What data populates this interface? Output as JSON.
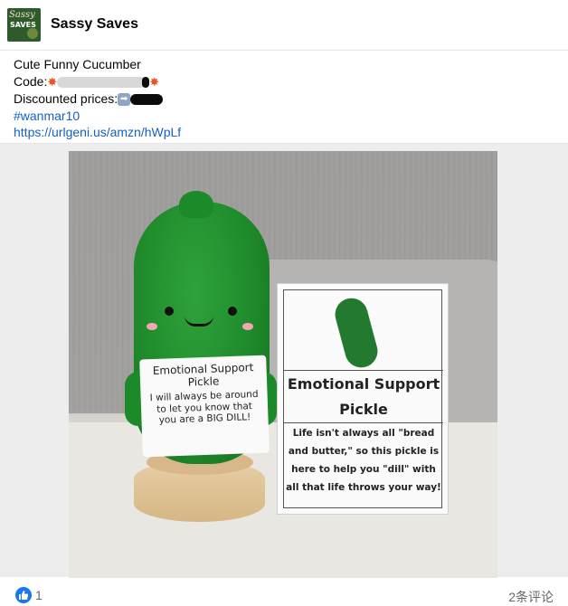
{
  "page": {
    "name": "Sassy Saves",
    "avatar_text_1": "Sassy",
    "avatar_text_2": "SAVES"
  },
  "post": {
    "line1": "Cute Funny Cucumber",
    "line2_label": "Code:",
    "line3_label": "Discounted prices:",
    "hashtag": "#wanmar10",
    "link": "https://urlgeni.us/amzn/hWpLf"
  },
  "photo": {
    "small_card_title": "Emotional Support Pickle",
    "small_card_body": "I will always be around to let you know that you are a BIG DILL!",
    "big_card_title_1": "Emotional Support",
    "big_card_title_2": "Pickle",
    "big_card_body": "Life isn't always all \"bread and butter,\" so this pickle is here to help you \"dill\" with all that life throws your way!"
  },
  "footer": {
    "like_count": "1",
    "comment_count": "2条评论"
  },
  "colors": {
    "link": "#1461c4",
    "like": "#1877f2",
    "muted": "#65676b"
  }
}
